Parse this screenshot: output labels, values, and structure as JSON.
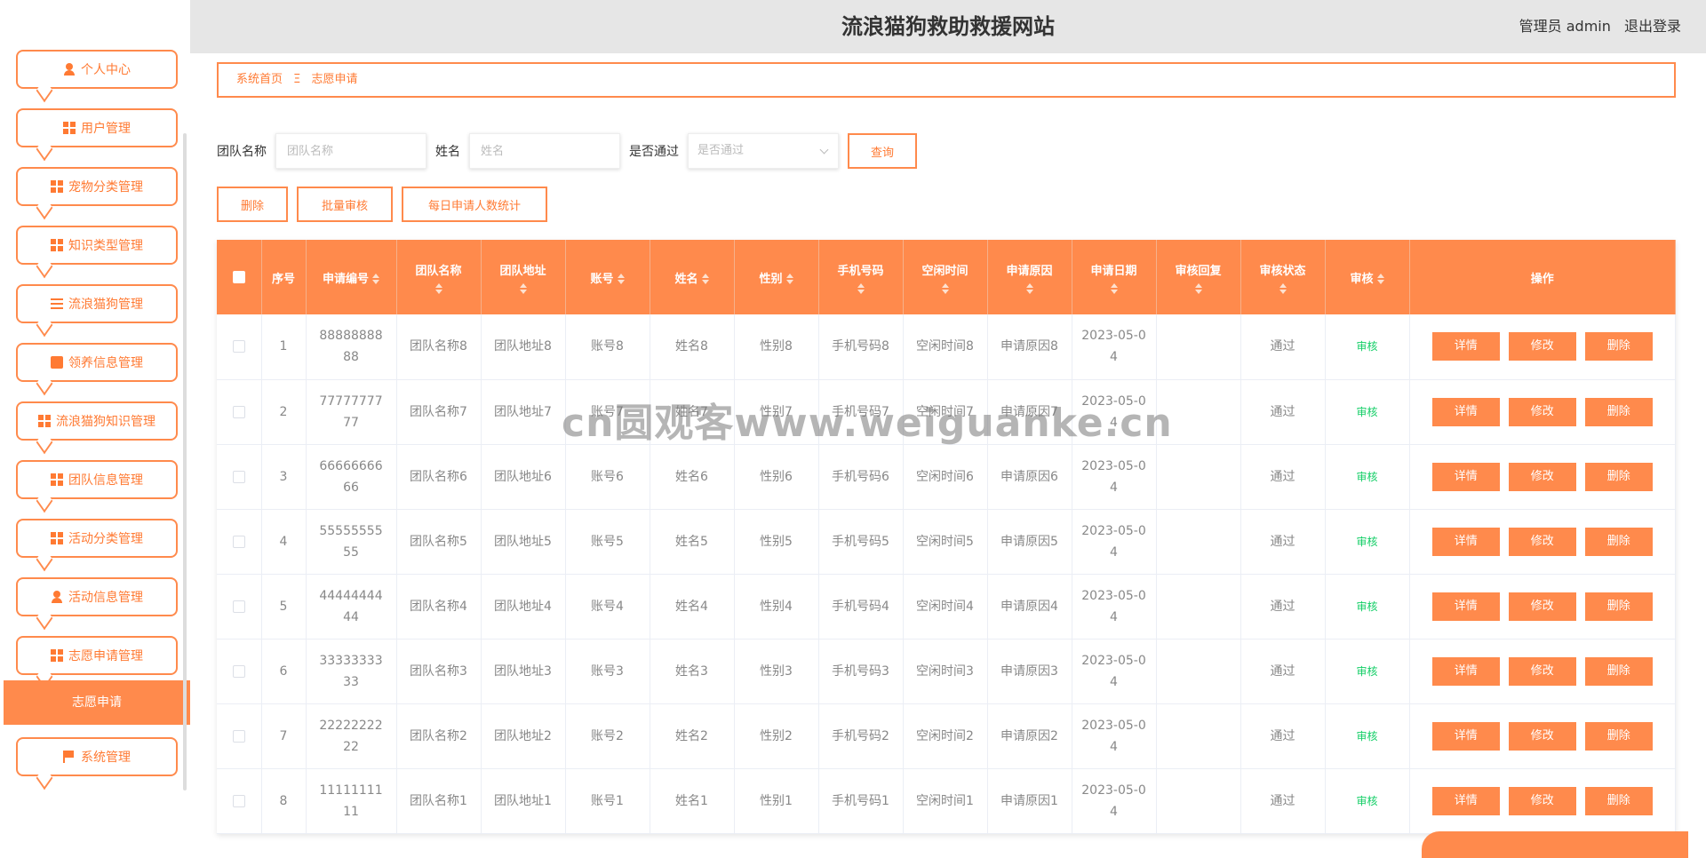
{
  "header": {
    "title": "流浪猫狗救助救援网站",
    "role": "管理员 admin",
    "logout": "退出登录"
  },
  "sidebar": {
    "items": [
      {
        "label": "个人中心",
        "icon": "user-icon"
      },
      {
        "label": "用户管理",
        "icon": "grid-icon"
      },
      {
        "label": "宠物分类管理",
        "icon": "grid-icon"
      },
      {
        "label": "知识类型管理",
        "icon": "grid-icon"
      },
      {
        "label": "流浪猫狗管理",
        "icon": "list-icon"
      },
      {
        "label": "领养信息管理",
        "icon": "clipboard-icon"
      },
      {
        "label": "流浪猫狗知识管理",
        "icon": "grid-icon"
      },
      {
        "label": "团队信息管理",
        "icon": "grid-icon"
      },
      {
        "label": "活动分类管理",
        "icon": "grid-icon"
      },
      {
        "label": "活动信息管理",
        "icon": "user-icon"
      },
      {
        "label": "志愿申请管理",
        "icon": "grid-icon"
      },
      {
        "label": "系统管理",
        "icon": "flag-icon"
      }
    ],
    "active_sub": "志愿申请"
  },
  "breadcrumb": {
    "home": "系统首页",
    "sep": "Ξ",
    "current": "志愿申请"
  },
  "filter": {
    "team_label": "团队名称",
    "team_placeholder": "团队名称",
    "name_label": "姓名",
    "name_placeholder": "姓名",
    "pass_label": "是否通过",
    "pass_placeholder": "是否通过",
    "query": "查询"
  },
  "actions": {
    "delete": "删除",
    "batch_audit": "批量审核",
    "daily_stats": "每日申请人数统计"
  },
  "table": {
    "headers": [
      "序号",
      "申请编号",
      "团队名称",
      "团队地址",
      "账号",
      "姓名",
      "性别",
      "手机号码",
      "空闲时间",
      "申请原因",
      "申请日期",
      "审核回复",
      "审核状态",
      "审核",
      "操作"
    ],
    "rows": [
      {
        "idx": "1",
        "appno": "8888888888",
        "team": "团队名称8",
        "addr": "团队地址8",
        "acct": "账号8",
        "name": "姓名8",
        "sex": "性别8",
        "phone": "手机号码8",
        "free": "空闲时间8",
        "reason": "申请原因8",
        "date": "2023-05-04",
        "reply": "",
        "status": "通过",
        "audit": "审核"
      },
      {
        "idx": "2",
        "appno": "7777777777",
        "team": "团队名称7",
        "addr": "团队地址7",
        "acct": "账号7",
        "name": "姓名7",
        "sex": "性别7",
        "phone": "手机号码7",
        "free": "空闲时间7",
        "reason": "申请原因7",
        "date": "2023-05-04",
        "reply": "",
        "status": "通过",
        "audit": "审核"
      },
      {
        "idx": "3",
        "appno": "6666666666",
        "team": "团队名称6",
        "addr": "团队地址6",
        "acct": "账号6",
        "name": "姓名6",
        "sex": "性别6",
        "phone": "手机号码6",
        "free": "空闲时间6",
        "reason": "申请原因6",
        "date": "2023-05-04",
        "reply": "",
        "status": "通过",
        "audit": "审核"
      },
      {
        "idx": "4",
        "appno": "5555555555",
        "team": "团队名称5",
        "addr": "团队地址5",
        "acct": "账号5",
        "name": "姓名5",
        "sex": "性别5",
        "phone": "手机号码5",
        "free": "空闲时间5",
        "reason": "申请原因5",
        "date": "2023-05-04",
        "reply": "",
        "status": "通过",
        "audit": "审核"
      },
      {
        "idx": "5",
        "appno": "4444444444",
        "team": "团队名称4",
        "addr": "团队地址4",
        "acct": "账号4",
        "name": "姓名4",
        "sex": "性别4",
        "phone": "手机号码4",
        "free": "空闲时间4",
        "reason": "申请原因4",
        "date": "2023-05-04",
        "reply": "",
        "status": "通过",
        "audit": "审核"
      },
      {
        "idx": "6",
        "appno": "3333333333",
        "team": "团队名称3",
        "addr": "团队地址3",
        "acct": "账号3",
        "name": "姓名3",
        "sex": "性别3",
        "phone": "手机号码3",
        "free": "空闲时间3",
        "reason": "申请原因3",
        "date": "2023-05-04",
        "reply": "",
        "status": "通过",
        "audit": "审核"
      },
      {
        "idx": "7",
        "appno": "2222222222",
        "team": "团队名称2",
        "addr": "团队地址2",
        "acct": "账号2",
        "name": "姓名2",
        "sex": "性别2",
        "phone": "手机号码2",
        "free": "空闲时间2",
        "reason": "申请原因2",
        "date": "2023-05-04",
        "reply": "",
        "status": "通过",
        "audit": "审核"
      },
      {
        "idx": "8",
        "appno": "1111111111",
        "team": "团队名称1",
        "addr": "团队地址1",
        "acct": "账号1",
        "name": "姓名1",
        "sex": "性别1",
        "phone": "手机号码1",
        "free": "空闲时间1",
        "reason": "申请原因1",
        "date": "2023-05-04",
        "reply": "",
        "status": "通过",
        "audit": "审核"
      }
    ],
    "row_buttons": {
      "detail": "详情",
      "edit": "修改",
      "delete": "删除"
    }
  },
  "watermark": "cn圆观客www.weiguanke.cn",
  "colors": {
    "accent": "#ff8a4c",
    "status_green": "#13ce66",
    "header_bg": "#e6e6e6"
  }
}
